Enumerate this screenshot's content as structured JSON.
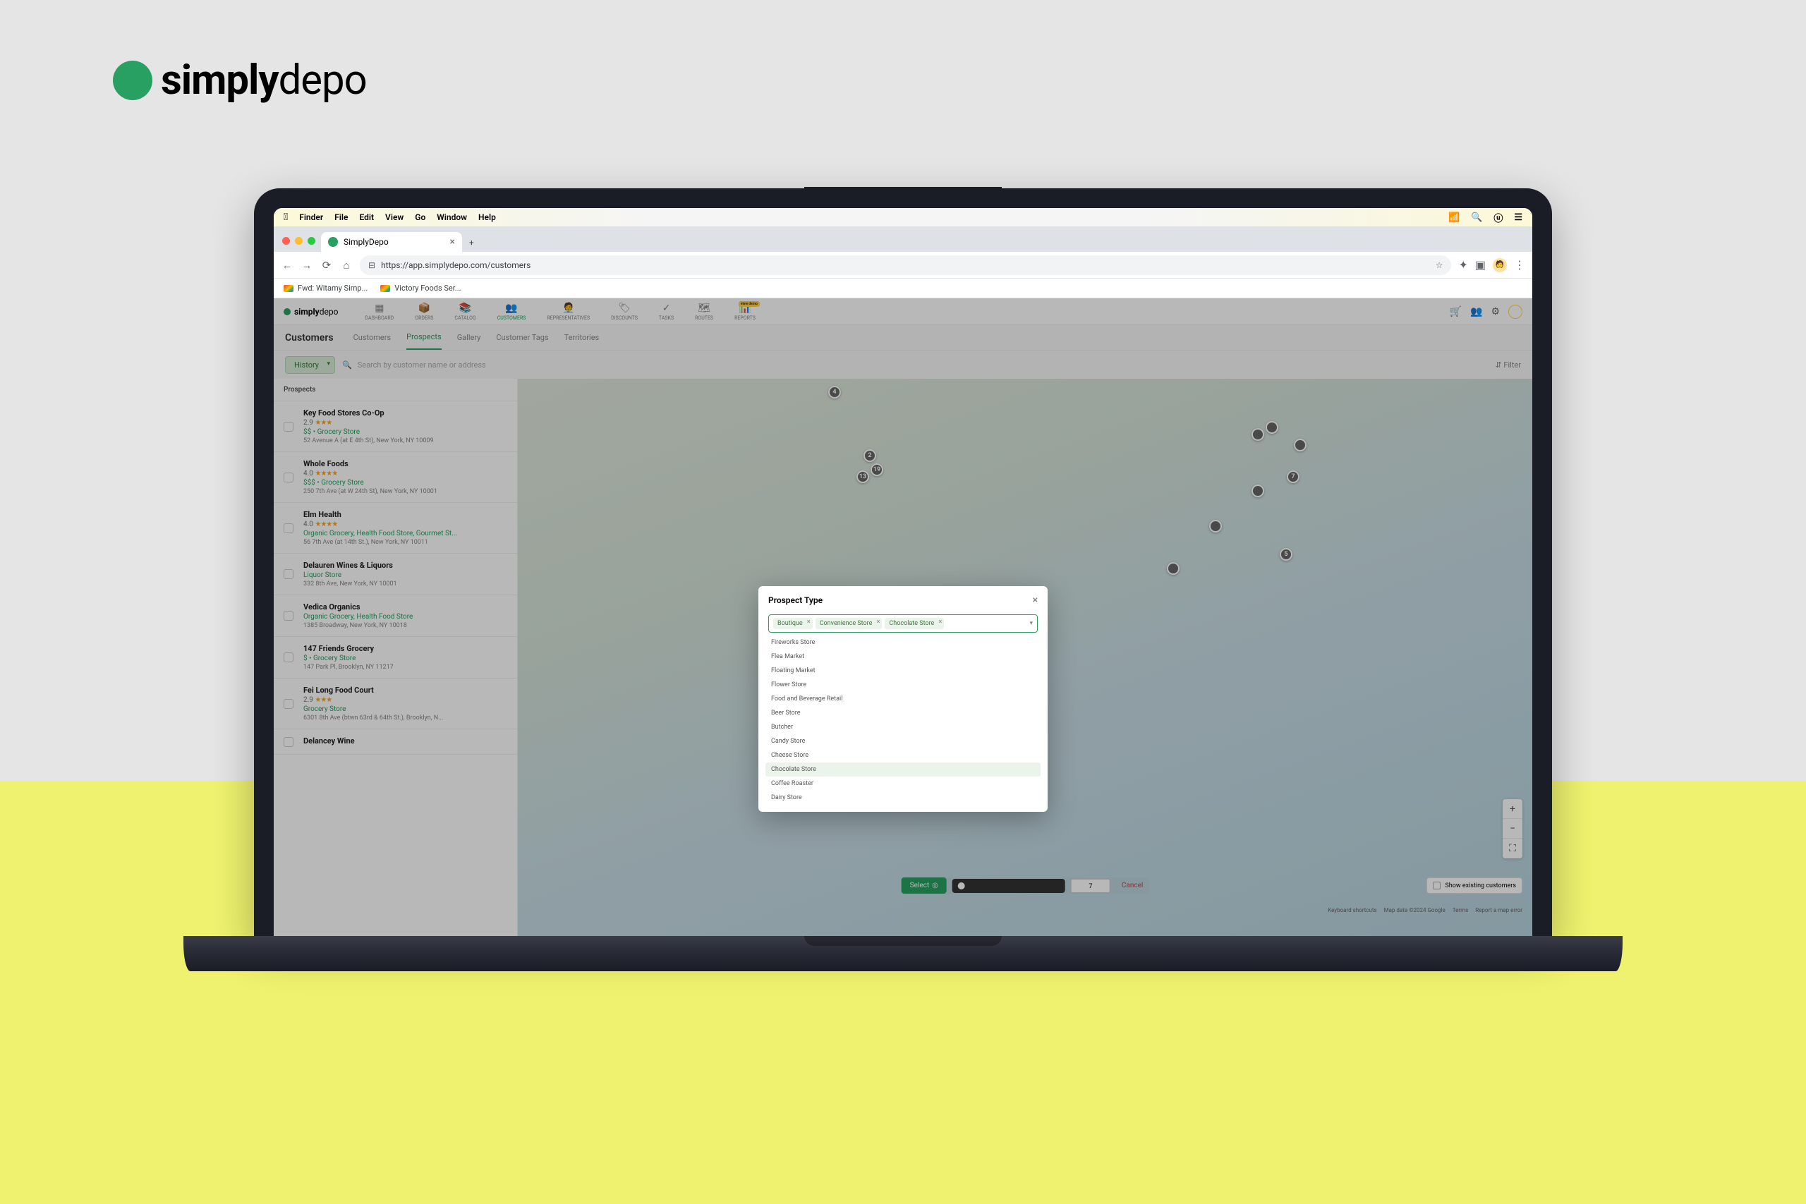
{
  "brand": {
    "bold": "simply",
    "light": "depo"
  },
  "macos": {
    "menus": [
      "Finder",
      "File",
      "Edit",
      "View",
      "Go",
      "Window",
      "Help"
    ]
  },
  "chrome": {
    "tab_title": "SimplyDepo",
    "url": "https://app.simplydepo.com/customers"
  },
  "bookmarks": [
    {
      "label": "Fwd: Witamy Simp..."
    },
    {
      "label": "Victory Foods Ser..."
    }
  ],
  "app": {
    "nav": [
      {
        "label": "DASHBOARD",
        "active": false
      },
      {
        "label": "ORDERS",
        "active": false
      },
      {
        "label": "CATALOG",
        "active": false
      },
      {
        "label": "CUSTOMERS",
        "active": true
      },
      {
        "label": "REPRESENTATIVES",
        "active": false
      },
      {
        "label": "DISCOUNTS",
        "active": false
      },
      {
        "label": "TASKS",
        "active": false
      },
      {
        "label": "ROUTES",
        "active": false
      },
      {
        "label": "REPORTS",
        "active": false,
        "badge": "view demo"
      }
    ],
    "page_title": "Customers",
    "tabs": [
      {
        "label": "Customers",
        "active": false
      },
      {
        "label": "Prospects",
        "active": true
      },
      {
        "label": "Gallery",
        "active": false
      },
      {
        "label": "Customer Tags",
        "active": false
      },
      {
        "label": "Territories",
        "active": false
      }
    ],
    "history_btn": "History",
    "search_placeholder": "Search by customer name or address",
    "filter_label": "Filter",
    "sidebar_title": "Prospects",
    "prospects": [
      {
        "name": "Key Food Stores Co-Op",
        "rating": "2.9",
        "count": "$$",
        "categories": "Grocery Store",
        "address": "52 Avenue A (at E 4th St), New York, NY 10009"
      },
      {
        "name": "Whole Foods",
        "rating": "4.0",
        "count": "$$$",
        "categories": "Grocery Store",
        "address": "250 7th Ave (at W 24th St), New York, NY 10001"
      },
      {
        "name": "Elm Health",
        "rating": "4.0",
        "count": "",
        "categories": "Organic Grocery, Health Food Store, Gourmet St...",
        "address": "56 7th Ave (at 14th St.), New York, NY 10011"
      },
      {
        "name": "Delauren Wines & Liquors",
        "rating": "",
        "count": "",
        "categories": "Liquor Store",
        "address": "332 8th Ave, New York, NY 10001"
      },
      {
        "name": "Vedica Organics",
        "rating": "",
        "count": "",
        "categories": "Organic Grocery, Health Food Store",
        "address": "1385 Broadway, New York, NY 10018"
      },
      {
        "name": "147 Friends Grocery",
        "rating": "",
        "count": "$",
        "categories": "Grocery Store",
        "address": "147 Park Pl, Brooklyn, NY 11217"
      },
      {
        "name": "Fei Long Food Court",
        "rating": "2.9",
        "count": "",
        "categories": "Grocery Store",
        "address": "6301 8th Ave (btwn 63rd & 64th St.), Brooklyn, N..."
      },
      {
        "name": "Delancey Wine",
        "rating": "",
        "count": "",
        "categories": "",
        "address": ""
      }
    ],
    "map": {
      "select_btn": "Select",
      "distance": "7",
      "cancel": "Cancel",
      "show_existing": "Show existing customers",
      "attribution": [
        "Keyboard shortcuts",
        "Map data ©2024 Google",
        "Terms",
        "Report a map error"
      ]
    }
  },
  "modal": {
    "title": "Prospect Type",
    "selected": [
      "Boutique",
      "Convenience Store",
      "Chocolate Store"
    ],
    "options": [
      {
        "label": "Fireworks Store",
        "hl": false
      },
      {
        "label": "Flea Market",
        "hl": false
      },
      {
        "label": "Floating Market",
        "hl": false
      },
      {
        "label": "Flower Store",
        "hl": false
      },
      {
        "label": "Food and Beverage Retail",
        "hl": false
      },
      {
        "label": "Beer Store",
        "hl": false
      },
      {
        "label": "Butcher",
        "hl": false
      },
      {
        "label": "Candy Store",
        "hl": false
      },
      {
        "label": "Cheese Store",
        "hl": false
      },
      {
        "label": "Chocolate Store",
        "hl": true
      },
      {
        "label": "Coffee Roaster",
        "hl": false
      },
      {
        "label": "Dairy Store",
        "hl": false
      }
    ]
  }
}
